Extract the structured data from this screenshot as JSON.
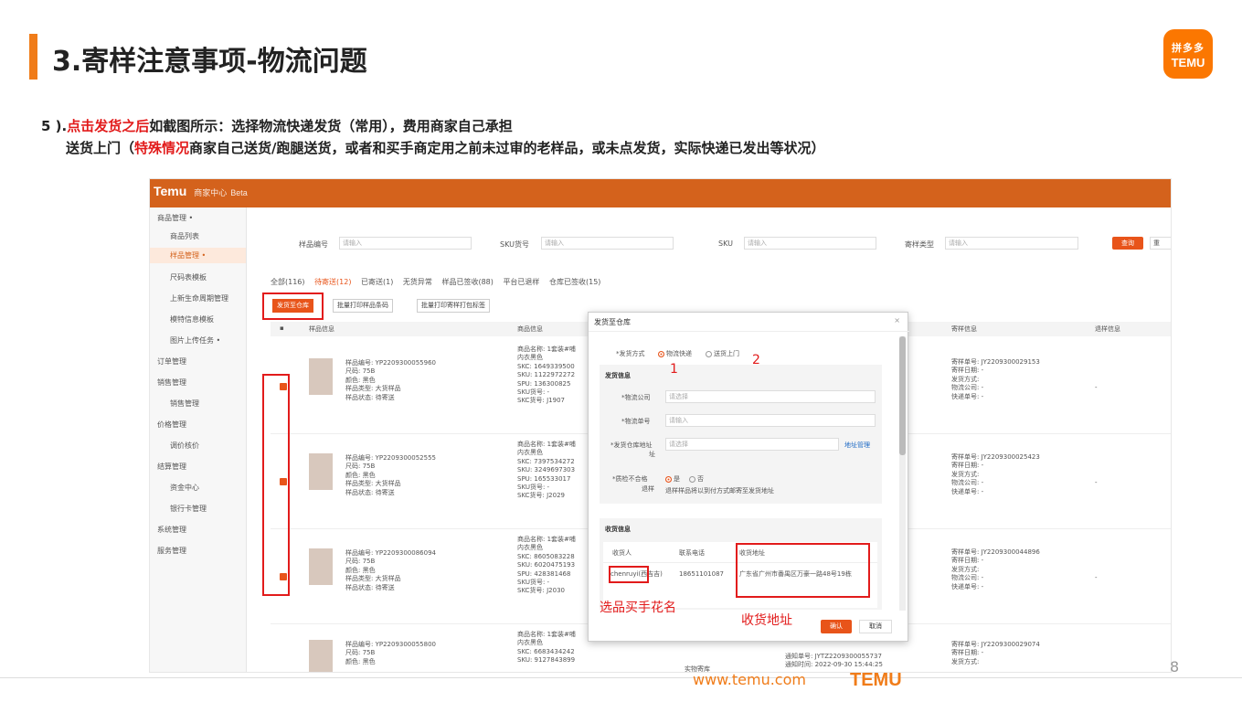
{
  "slide": {
    "title": "3.寄样注意事项-物流问题",
    "logo_line1": "拼多多",
    "logo_line2": "TEMU",
    "step_line1_prefix": "5 ).",
    "step_line1_red": "点击发货之后",
    "step_line1_rest": "如截图所示：选择物流快递发货（常用），费用商家自己承担",
    "step_line2_prefix": "送货上门（",
    "step_line2_red": "特殊情况",
    "step_line2_rest": "商家自己送货/跑腿送货，或者和买手商定用之前未过审的老样品，或未点发货，实际快递已发出等状况）",
    "footer_url": "www.temu.com",
    "footer_logo": "TEMU",
    "page_number": "8"
  },
  "app": {
    "brand": "Temu",
    "brand_sub": "商家中心",
    "brand_beta": "Beta"
  },
  "sidebar": {
    "items": [
      "商品管理 •",
      "商品列表",
      "样品管理 •",
      "尺码表模板",
      "上新生命周期管理",
      "模特信息模板",
      "图片上传任务 •",
      "订单管理",
      "销售管理",
      "销售管理",
      "价格管理",
      "调价核价",
      "结算管理",
      "资金中心",
      "银行卡管理",
      "系统管理",
      "服务管理"
    ]
  },
  "filters": {
    "sample_no_label": "样品编号",
    "sample_no_placeholder": "请输入",
    "sku_code_label": "SKU货号",
    "sku_code_placeholder": "请输入",
    "sku_label": "SKU",
    "sku_placeholder": "请输入",
    "send_type_label": "寄样类型",
    "send_type_placeholder": "请输入",
    "query_btn": "查询",
    "reset_btn": "重"
  },
  "tabs": [
    "全部(116)",
    "待寄送(12)",
    "已寄送(1)",
    "无货异常",
    "样品已签收(88)",
    "平台已退样",
    "仓库已签收(15)"
  ],
  "actions": {
    "ship_btn": "发货至仓库",
    "print_code_btn": "批量打印样品条码",
    "print_label_btn": "批量打印寄样打包标签"
  },
  "table": {
    "headers": [
      "样品信息",
      "商品信息",
      "寄样信息",
      "退样信息"
    ],
    "rows": [
      {
        "sample": "样品编号: YP2209300055960\n尺码: 75B\n颜色: 黑色\n样品类型: 大货样品\n样品状态: 待寄送",
        "product": "商品名称: 1套装#哺\n内衣黑色\nSKC: 1649339500\nSKU: 1122972272\nSPU: 136300825\nSKU货号: -\nSKC货号: J1907",
        "send": "寄样单号: JY2209300029153\n寄样日期: -\n发货方式:\n物流公司: -\n快递单号: -",
        "return": "-"
      },
      {
        "sample": "样品编号: YP2209300052555\n尺码: 75B\n颜色: 黑色\n样品类型: 大货样品\n样品状态: 待寄送",
        "product": "商品名称: 1套装#哺\n内衣黑色\nSKC: 7397534272\nSKU: 3249697303\nSPU: 165533017\nSKU货号: -\nSKC货号: J2029",
        "send": "寄样单号: JY2209300025423\n寄样日期: -\n发货方式:\n物流公司: -\n快递单号: -",
        "return": "-"
      },
      {
        "sample": "样品编号: YP2209300086094\n尺码: 75B\n颜色: 黑色\n样品类型: 大货样品\n样品状态: 待寄送",
        "product": "商品名称: 1套装#哺\n内衣黑色\nSKC: 8605083228\nSKU: 6020475193\nSPU: 428381468\nSKU货号: -\nSKC货号: J2030",
        "send": "寄样单号: JY2209300044896\n寄样日期: -\n发货方式:\n物流公司: -\n快递单号: -",
        "return": "-"
      },
      {
        "sample": "样品编号: YP2209300055800\n尺码: 75B\n颜色: 黑色",
        "product": "商品名称: 1套装#哺\n内衣黑色\nSKC: 6683434242\nSKU: 9127843899",
        "send": "寄样单号: JY2209300029074\n寄样日期: -\n发货方式:",
        "return": ""
      }
    ],
    "extra_cell_1": "实物寄库",
    "extra_cell_2": "通知单号: JYTZ2209300055737\n通知时间: 2022-09-30 15:44:25"
  },
  "dialog": {
    "title": "发货至仓库",
    "close": "×",
    "method_label": "*发货方式",
    "method_opt1": "物流快递",
    "method_opt2": "送货上门",
    "ship_info": "发货信息",
    "carrier_label": "*物流公司",
    "carrier_placeholder": "请选择",
    "tracking_label": "*物流单号",
    "tracking_placeholder": "请输入",
    "warehouse_label": "*发货仓库地址",
    "warehouse_label2": "址",
    "warehouse_placeholder": "请选择",
    "addr_manage": "地址管理",
    "reject_label": "*质检不合格",
    "reject_label2": "退样",
    "reject_yes": "是",
    "reject_no": "否",
    "reject_note": "退样样品将以到付方式邮寄至发货地址",
    "recv_info": "收货信息",
    "recv_name_h": "收货人",
    "recv_phone_h": "联系电话",
    "recv_addr_h": "收货地址",
    "recv_name": "chenruyi(西吉吉)",
    "recv_phone": "18651101087",
    "recv_addr": "广东省广州市番禺区万豪一路48号19栋",
    "confirm": "确认",
    "cancel": "取消"
  },
  "annotations": {
    "n1": "1",
    "n2": "2",
    "buyer": "选品买手花名",
    "addr": "收货地址"
  }
}
